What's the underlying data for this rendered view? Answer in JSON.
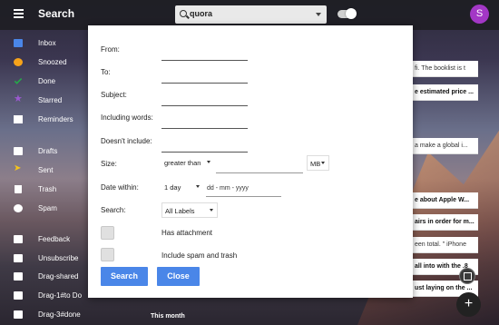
{
  "header": {
    "title": "Search",
    "search_value": "quora",
    "avatar_letter": "S",
    "avatar_color": "#a337c6"
  },
  "sidebar": {
    "items": [
      {
        "label": "Inbox",
        "icon": "inbox-icon"
      },
      {
        "label": "Snoozed",
        "icon": "clock-icon"
      },
      {
        "label": "Done",
        "icon": "check-icon"
      },
      {
        "label": "Starred",
        "icon": "star-icon"
      },
      {
        "label": "Reminders",
        "icon": "reminder-icon"
      },
      {
        "label": "Drafts",
        "icon": "mail-icon"
      },
      {
        "label": "Sent",
        "icon": "send-icon"
      },
      {
        "label": "Trash",
        "icon": "trash-icon"
      },
      {
        "label": "Spam",
        "icon": "spam-icon"
      },
      {
        "label": "Feedback",
        "icon": "mail-icon"
      },
      {
        "label": "Unsubscribe",
        "icon": "mail-icon"
      },
      {
        "label": "Drag-shared",
        "icon": "mail-icon"
      },
      {
        "label": "Drag-1#to Do",
        "icon": "mail-icon"
      },
      {
        "label": "Drag-3#done",
        "icon": "mail-icon"
      }
    ]
  },
  "emails": [
    {
      "snippet": "fi. The booklist is t"
    },
    {
      "snippet": "e estimated price ..."
    },
    {
      "snippet": "a make a global i..."
    },
    {
      "snippet": "e about Apple W..."
    },
    {
      "snippet": "airs in order for m..."
    },
    {
      "snippet": "een total. \" iPhone"
    },
    {
      "snippet": "all into with the .8"
    },
    {
      "snippet": "ust laying on the ..."
    }
  ],
  "search_form": {
    "from_label": "From:",
    "to_label": "To:",
    "subject_label": "Subject:",
    "including_label": "Including words:",
    "not_include_label": "Doesn't include:",
    "size_label": "Size:",
    "size_operator": "greater than",
    "size_unit": "MB",
    "date_label": "Date within:",
    "date_range": "1 day",
    "date_placeholder": "dd - mm - yyyy",
    "search_label": "Search:",
    "search_scope": "All Labels",
    "has_attachment_label": "Has attachment",
    "include_spam_label": "Include spam and trash",
    "search_button": "Search",
    "close_button": "Close"
  },
  "footer": {
    "section_label": "This month"
  },
  "colors": {
    "accent": "#4a86e8",
    "topbar": "#1e1e24"
  }
}
